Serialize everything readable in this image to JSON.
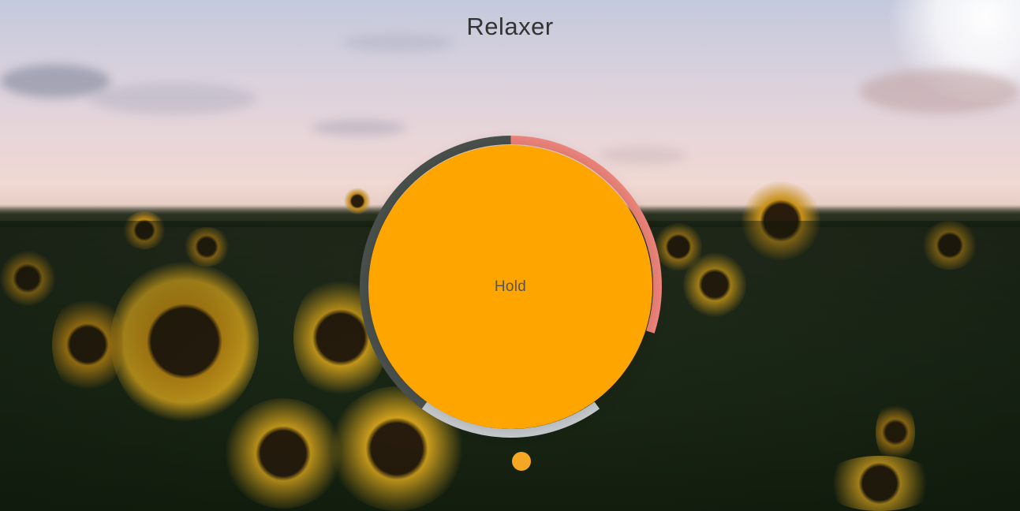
{
  "app": {
    "title": "Relaxer"
  },
  "breathe": {
    "instruction": "Hold",
    "circle_color": "#ffa500"
  },
  "ring": {
    "segments": [
      {
        "phase": "breathe-in",
        "color": "#4b524e",
        "fraction": 0.5
      },
      {
        "phase": "hold",
        "color": "#f0867c",
        "fraction": 0.3
      },
      {
        "phase": "breathe-out",
        "color": "#c9cdd0",
        "fraction": 0.2
      }
    ]
  },
  "pointer": {
    "color": "#f5a623"
  }
}
